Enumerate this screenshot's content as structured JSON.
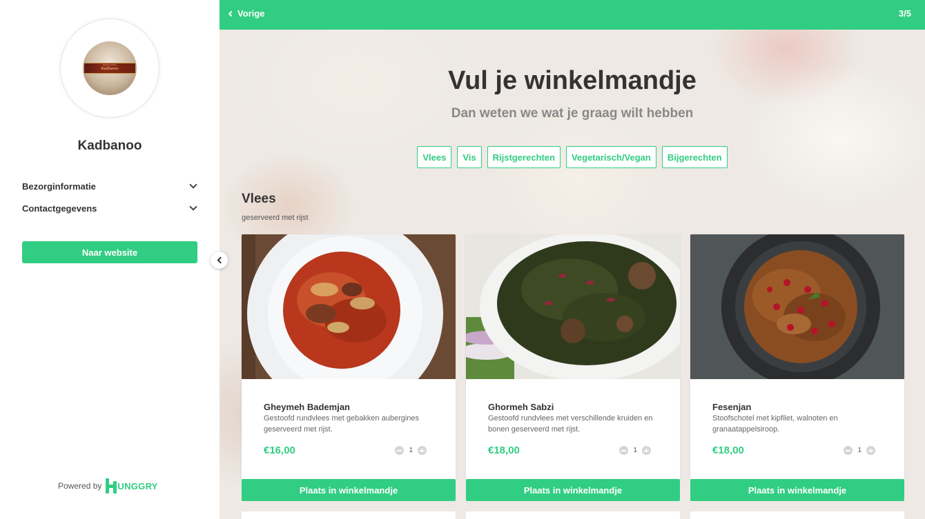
{
  "sidebar": {
    "logo": {
      "line1": "Perzisch eethuis",
      "line2": "Kadbanoo"
    },
    "shop_name": "Kadbanoo",
    "accordion": [
      {
        "label": "Bezorginformatie"
      },
      {
        "label": "Contactgegevens"
      }
    ],
    "website_button": "Naar website",
    "powered_by": "Powered by",
    "brand": "UNGGRY"
  },
  "topbar": {
    "back_label": "Vorige",
    "step": "3/5"
  },
  "hero": {
    "title": "Vul je winkelmandje",
    "subtitle": "Dan weten we wat je graag wilt hebben"
  },
  "categories": [
    "Vlees",
    "Vis",
    "Rijstgerechten",
    "Vegetarisch/Vegan",
    "Bijgerechten"
  ],
  "section": {
    "title": "Vlees",
    "subtitle": "geserveerd met rijst"
  },
  "products": [
    {
      "name": "Gheymeh Bademjan",
      "description": "Gestoofd rundvlees met gebakken aubergines geserveerd met rijst.",
      "price": "€16,00",
      "qty": "1",
      "button": "Plaats in winkelmandje"
    },
    {
      "name": "Ghormeh Sabzi",
      "description": "Gestoofd rundvlees met verschillende kruiden en bonen geserveerd met rijst.",
      "price": "€18,00",
      "qty": "1",
      "button": "Plaats in winkelmandje"
    },
    {
      "name": "Fesenjan",
      "description": "Stoofschotel met kipfilet, walnoten en granaatappelsiroop.",
      "price": "€18,00",
      "qty": "1",
      "button": "Plaats in winkelmandje"
    }
  ],
  "colors": {
    "accent": "#31cd82",
    "text": "#333333"
  }
}
